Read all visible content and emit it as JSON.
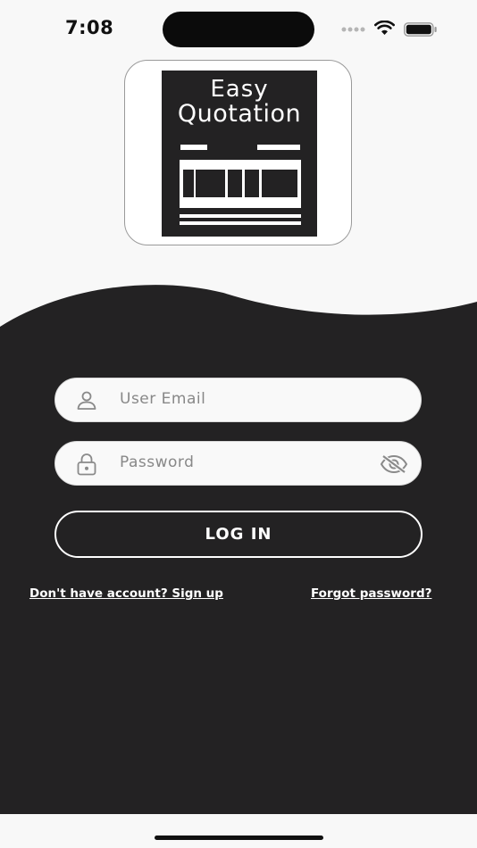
{
  "status_bar": {
    "time": "7:08",
    "icons": [
      "signal-dots-icon",
      "wifi-icon",
      "battery-icon"
    ]
  },
  "logo": {
    "line1": "Easy",
    "line2": "Quotation"
  },
  "form": {
    "email_placeholder": "User Email",
    "password_placeholder": "Password",
    "login_label": "LOG IN",
    "signup_link": "Don't have account? Sign up",
    "forgot_link": "Forgot password?"
  },
  "colors": {
    "dark": "#232223",
    "light": "#f8f8f8",
    "field_bg": "#f9f9f9",
    "icon_grey": "#8a8a8a"
  }
}
